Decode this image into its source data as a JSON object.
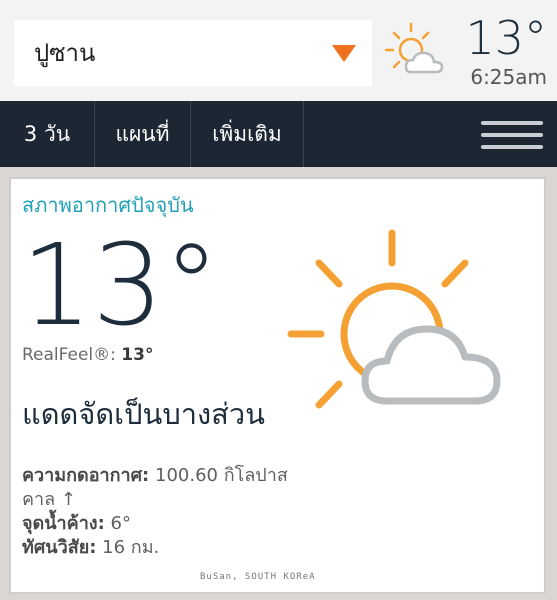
{
  "header": {
    "location": "ปูซาน",
    "temperature": "13°",
    "time": "6:25am",
    "icon": "partly-sunny-icon"
  },
  "nav": {
    "tabs": [
      {
        "label": "3 วัน"
      },
      {
        "label": "แผนที่"
      },
      {
        "label": "เพิ่มเติม"
      }
    ],
    "menu_icon": "hamburger-menu-icon"
  },
  "current": {
    "section_title": "สภาพอากาศปัจจุบัน",
    "temperature": "13°",
    "realfeel_label": "RealFeel®:",
    "realfeel_value": "13°",
    "condition": "แดดจัดเป็นบางส่วน",
    "pressure_label": "ความกดอากาศ:",
    "pressure_value": "100.60 กิโลปาสคาล ↑",
    "dewpoint_label": "จุดน้ำค้าง:",
    "dewpoint_value": "6°",
    "visibility_label": "ทัศนวิสัย:",
    "visibility_value": "16 กม.",
    "icon": "partly-sunny-icon"
  },
  "watermark": "BuSan, SOUTH KOReA",
  "colors": {
    "accent": "#f07020",
    "nav_bg": "#1c2733",
    "section_title": "#22a2b8",
    "sun": "#f5a033",
    "cloud": "#b8bcbf"
  }
}
